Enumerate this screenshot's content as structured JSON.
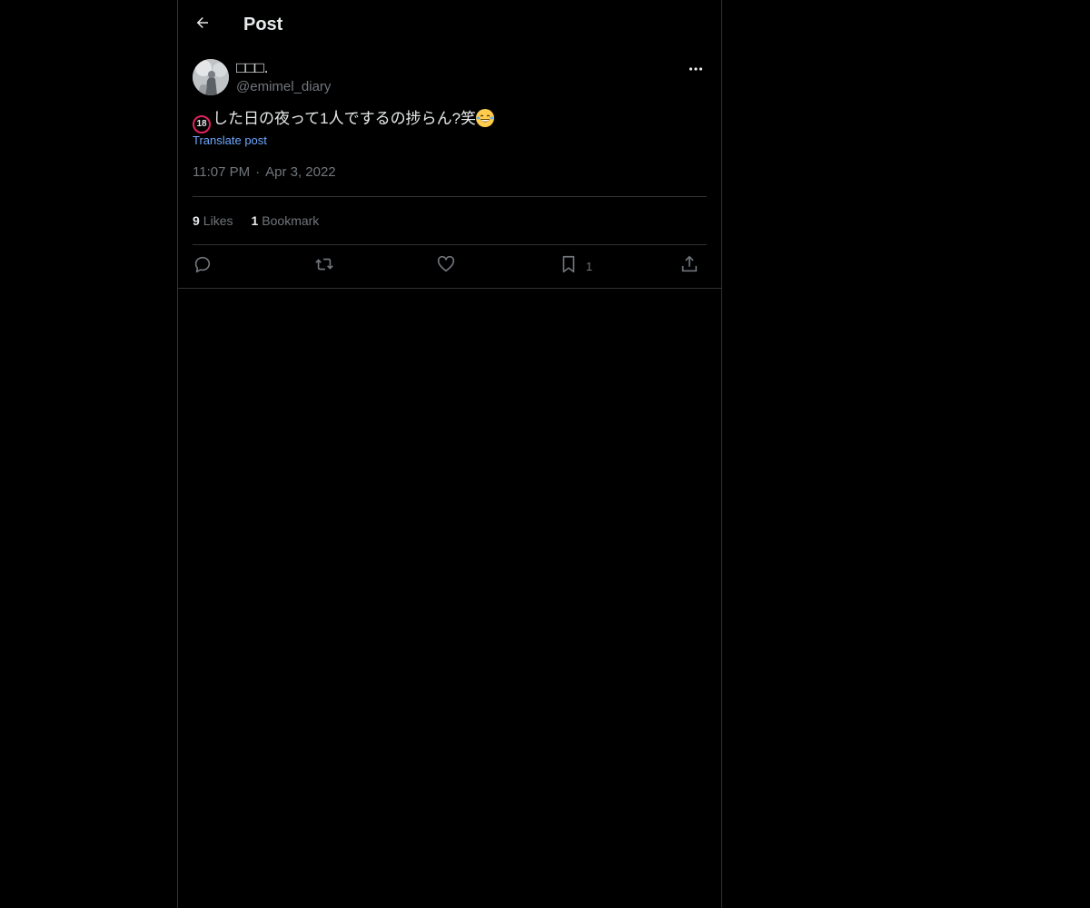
{
  "header": {
    "title": "Post"
  },
  "author": {
    "display_name": "□□□.",
    "handle": "@emimel_diary"
  },
  "post": {
    "badge": "18",
    "text": "した日の夜って1人でするの捗らん?笑",
    "translate_label": "Translate post",
    "time": "11:07 PM",
    "date": "Apr 3, 2022",
    "separator": "·"
  },
  "stats": {
    "likes_count": "9",
    "likes_label": "Likes",
    "bookmarks_count": "1",
    "bookmarks_label": "Bookmark"
  },
  "actions": {
    "bookmark_count": "1"
  },
  "colors": {
    "background": "#000000",
    "text": "#e7e9ea",
    "muted": "#71767b",
    "link": "#6ea8ff",
    "border": "#2f3336"
  }
}
